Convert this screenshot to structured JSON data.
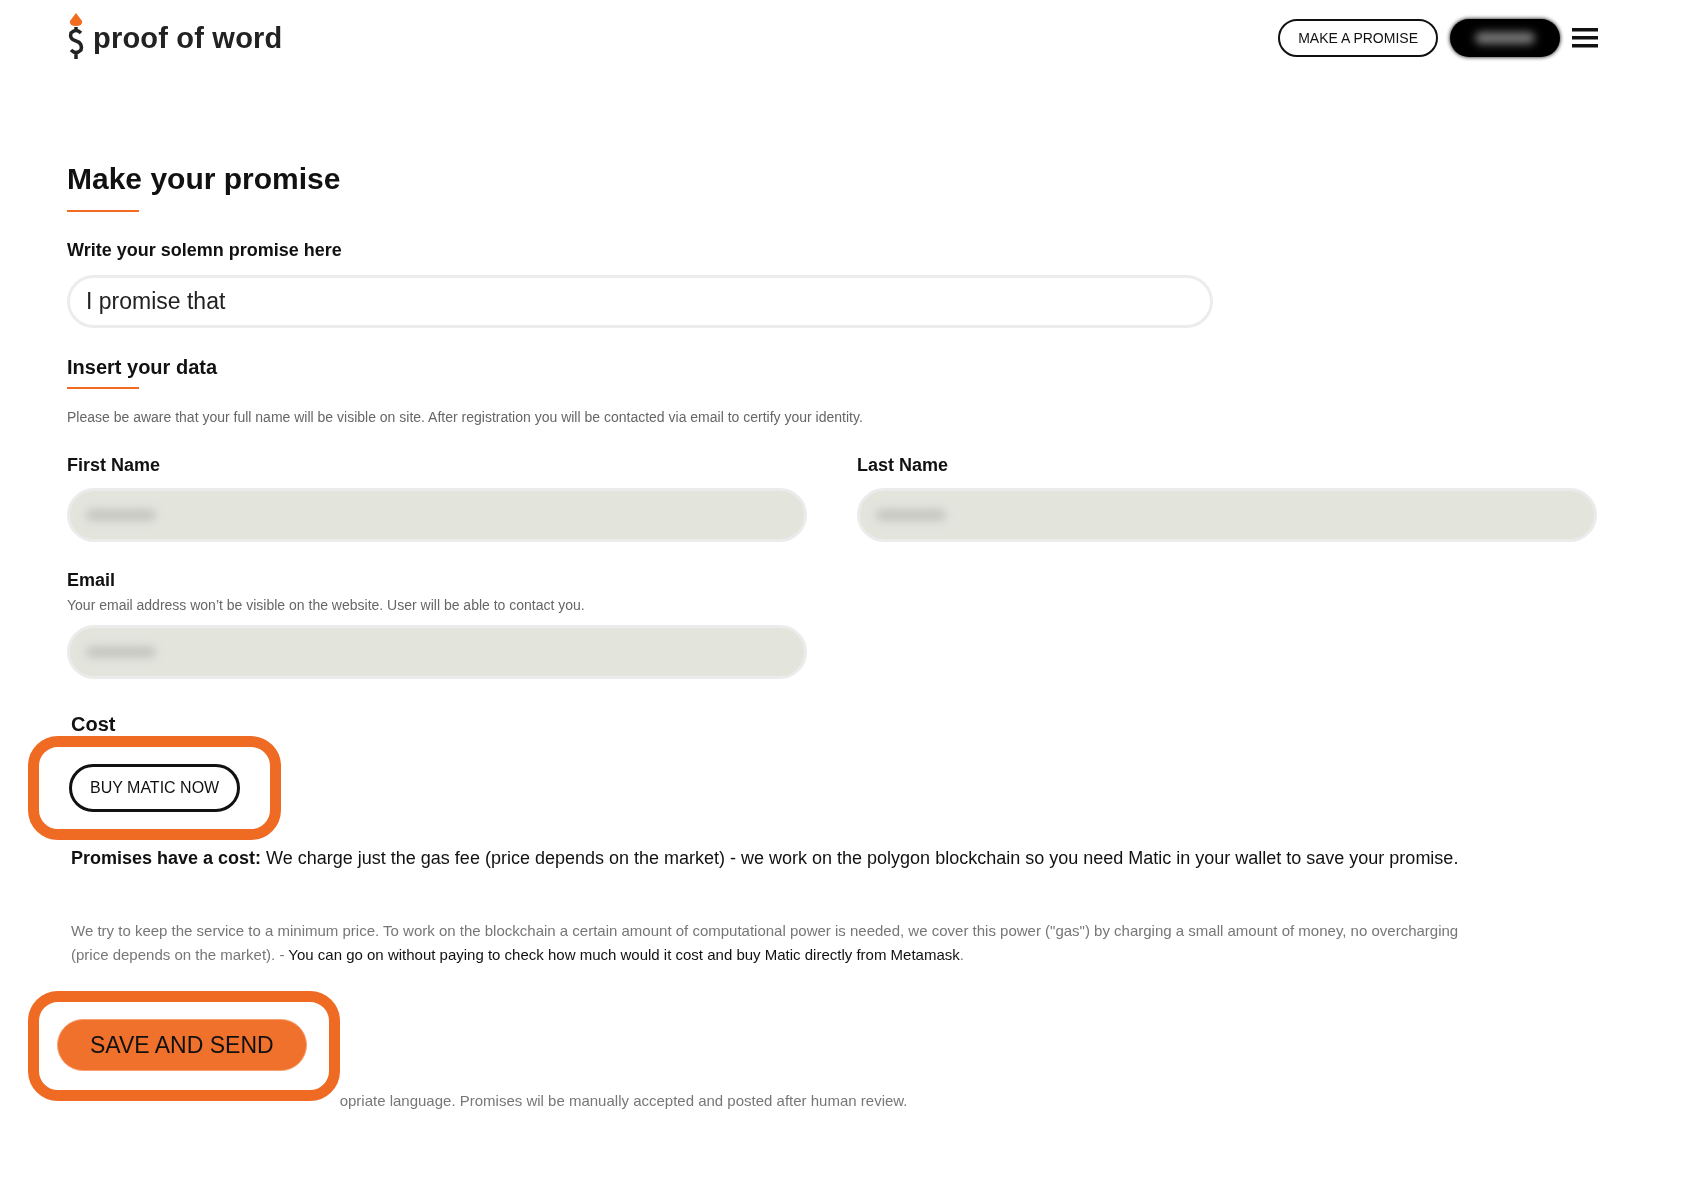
{
  "header": {
    "logo": "proof of word",
    "buttons": [
      {
        "label": "MAKE A PROMISE",
        "kind": "outline"
      },
      {
        "kind": "blurred"
      }
    ]
  },
  "title": "Make your promise",
  "promise": {
    "label": "Write your solemn promise here",
    "value": "I promise that"
  },
  "data_section": {
    "title": "Insert your data",
    "notice": "Please be aware that your full name will be visible on site. After registration you will be contacted via email to certify your identity."
  },
  "first_name": {
    "label": "First Name",
    "blurred": true
  },
  "last_name": {
    "label": "Last Name",
    "blurred": true
  },
  "email": {
    "label": "Email",
    "hint": "Your email address won’t be visible on the website. User will be able to contact you.",
    "blurred": true
  },
  "cost": {
    "title": "Cost",
    "button": {
      "label": "BUY MATIC NOW",
      "highlighted": true
    },
    "summary": "**Promises have a cost:** We charge just the gas fee (price depends on the market) - we work on the polygon blockchain so you need Matic in your wallet to save your promise.",
    "details": "We try to keep the service to a minimum price. To work on the blockchain a certain amount of computational power is needed, we cover this power (\"gas\") by charging a small amount of money, no overcharging (price depends on the market). - ",
    "details_bold": "You can go on without paying to check how much would it cost and buy Matic directly from Metamask",
    "details_end": "."
  },
  "submit": {
    "label": "SAVE AND SEND",
    "highlighted": true
  },
  "footer_note": "opriate language. Promises wil be manually accepted and posted after human review."
}
